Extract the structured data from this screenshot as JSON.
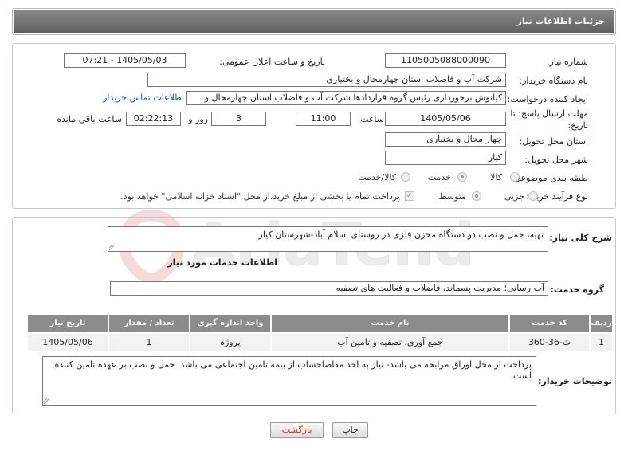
{
  "header": {
    "title": "جزئیات اطلاعات نیاز"
  },
  "form": {
    "need_number_label": "شماره نیاز:",
    "need_number": "1105005088000090",
    "announce_label": "تاریخ و ساعت اعلان عمومی:",
    "announce_value": "1405/05/03 - 07:21",
    "buyer_org_label": "نام دستگاه خریدار:",
    "buyer_org": "شرکت آب و فاضلاب استان چهارمحال و بختیاری",
    "creator_label": "ایجاد کننده درخواست:",
    "creator": "کیانوش برخورداری رئیس گروه قراردادها شرکت آب و فاضلاب استان چهارمحال و",
    "contact_link": "اطلاعات تماس خریدار",
    "deadline_label_1": "مهلت ارسال پاسخ: تا",
    "deadline_label_2": "تاریخ:",
    "deadline_date": "1405/05/06",
    "time_label": "ساعت",
    "deadline_time": "11:00",
    "days_value": "3",
    "days_label": "روز و",
    "remaining_time": "02:22:13",
    "remaining_label": "ساعت باقی مانده",
    "province_label": "استان محل تحویل:",
    "province": "چهار محال و بختیاری",
    "city_label": "شهر محل تحویل:",
    "city": "کیار",
    "category_label": "طبقه بندی موضوعی:",
    "category_options": [
      "کالا",
      "خدمت",
      "کالا/خدمت"
    ],
    "purchase_type_label": "نوع فرآیند خرید :",
    "purchase_options": [
      "جزیی",
      "متوسط"
    ],
    "payment_note": "پرداخت تمام یا بخشی از مبلغ خرید،از محل \"اسناد خزانه اسلامی\" خواهد بود."
  },
  "summary": {
    "label": "شرح کلی نیاز:",
    "text": "تهیه، حمل و نصب دو دستگاه مخزن فلزی در روستای اسلام آباد-شهرستان کیار",
    "services_title": "اطلاعات خدمات مورد نیاز",
    "service_group_label": "گروه خدمت:",
    "service_group": "آب رسانی؛ مدیریت پسماند، فاضلاب و فعالیت های تصفیه"
  },
  "table": {
    "headers": [
      "ردیف",
      "کد خدمت",
      "نام خدمت",
      "واحد اندازه گیری",
      "تعداد / مقدار",
      "تاریخ نیاز"
    ],
    "rows": [
      [
        "1",
        "ث-36-360",
        "جمع آوری، تصفیه و تامین آب",
        "پروژه",
        "1",
        "1405/05/06"
      ]
    ]
  },
  "notes": {
    "label": "توضیحات خریدار:",
    "text": "پرداخت از محل اوراق مرابحه می باشد- نیاز به اخذ مفاصاحساب از بیمه تامین اجتماعی می باشد. حمل و نصب بر عهده تامین کننده است."
  },
  "buttons": {
    "print": "چاپ",
    "back": "بازگشت"
  },
  "watermark_text": "AriaTender.net",
  "colors": {
    "header_bg": "#6e6e6e",
    "link": "#1155cc",
    "back_text": "#c0392b"
  }
}
